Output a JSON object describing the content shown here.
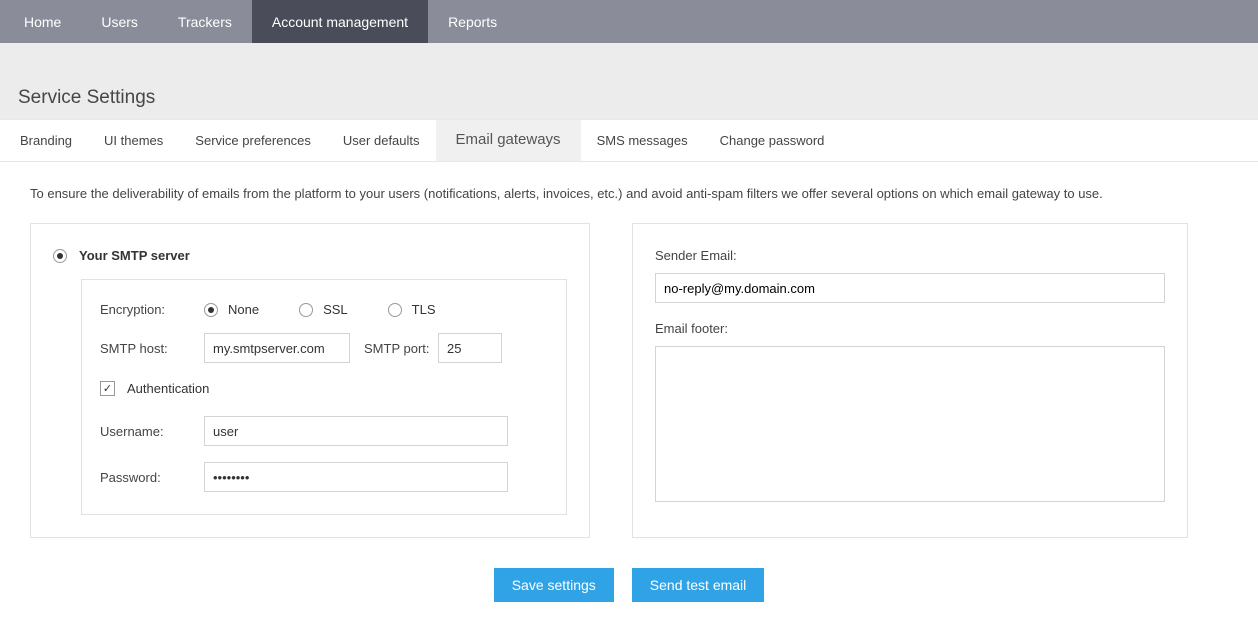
{
  "topNav": {
    "items": [
      {
        "label": "Home"
      },
      {
        "label": "Users"
      },
      {
        "label": "Trackers"
      },
      {
        "label": "Account management"
      },
      {
        "label": "Reports"
      }
    ],
    "activeIndex": 3
  },
  "pageTitle": "Service Settings",
  "subTabs": {
    "items": [
      {
        "label": "Branding"
      },
      {
        "label": "UI themes"
      },
      {
        "label": "Service preferences"
      },
      {
        "label": "User defaults"
      },
      {
        "label": "Email gateways"
      },
      {
        "label": "SMS messages"
      },
      {
        "label": "Change password"
      }
    ],
    "activeIndex": 4
  },
  "intro": "To ensure the deliverability of emails from the platform to your users (notifications, alerts, invoices, etc.) and avoid anti-spam filters we offer several options on which email gateway to use.",
  "smtp": {
    "serverRadioLabel": "Your SMTP server",
    "encryptionLabel": "Encryption:",
    "encryptionOptions": {
      "none": "None",
      "ssl": "SSL",
      "tls": "TLS"
    },
    "encryptionSelected": "none",
    "hostLabel": "SMTP host:",
    "hostValue": "my.smtpserver.com",
    "portLabel": "SMTP port:",
    "portValue": "25",
    "authLabel": "Authentication",
    "authChecked": true,
    "usernameLabel": "Username:",
    "usernameValue": "user",
    "passwordLabel": "Password:",
    "passwordValue": "••••••••"
  },
  "sender": {
    "emailLabel": "Sender Email:",
    "emailValue": "no-reply@my.domain.com",
    "footerLabel": "Email footer:",
    "footerValue": ""
  },
  "buttons": {
    "save": "Save settings",
    "test": "Send test email"
  }
}
